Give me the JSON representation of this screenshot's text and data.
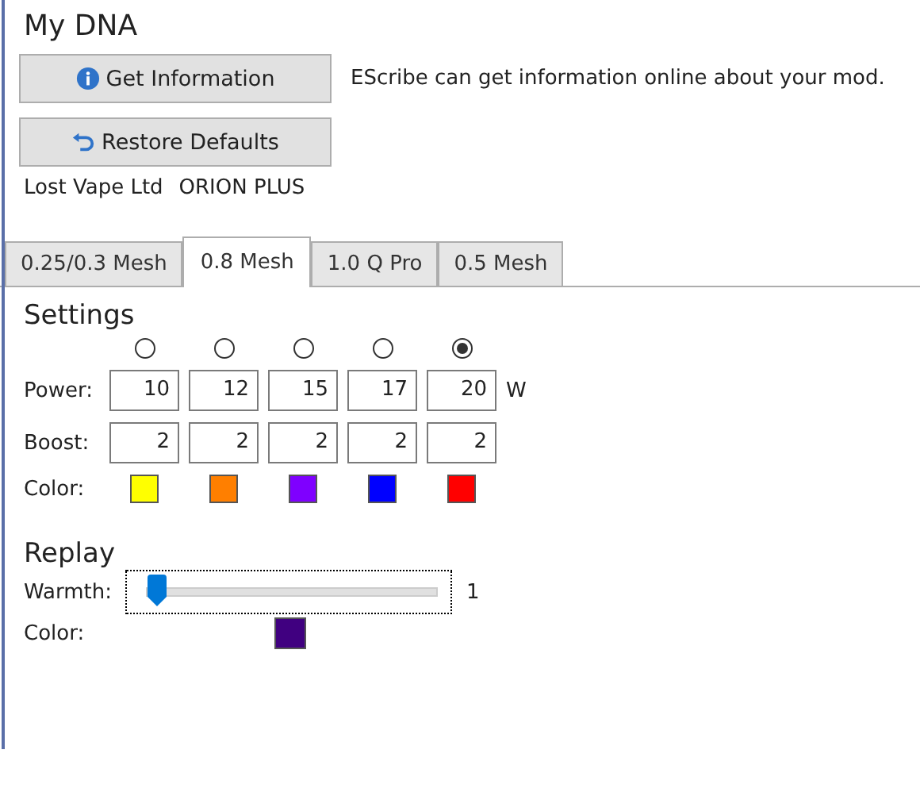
{
  "title": "My DNA",
  "buttons": [
    {
      "kind": "info",
      "label": "Get Information"
    },
    {
      "kind": "restore",
      "label": "Restore Defaults"
    }
  ],
  "info_text": "EScribe can get information online about your mod.",
  "manufacturer": "Lost Vape Ltd",
  "product": "ORION PLUS",
  "tabs": [
    {
      "label": "0.25/0.3 Mesh",
      "selected": false
    },
    {
      "label": "0.8 Mesh",
      "selected": true
    },
    {
      "label": "1.0 Q Pro",
      "selected": false
    },
    {
      "label": "0.5 Mesh",
      "selected": false
    }
  ],
  "settings": {
    "heading": "Settings",
    "power_label": "Power:",
    "boost_label": "Boost:",
    "color_label": "Color:",
    "power_unit": "W",
    "presets": [
      {
        "selected": false,
        "power": "10",
        "boost": "2",
        "color": "#ffff00"
      },
      {
        "selected": false,
        "power": "12",
        "boost": "2",
        "color": "#ff7f00"
      },
      {
        "selected": false,
        "power": "15",
        "boost": "2",
        "color": "#7f00ff"
      },
      {
        "selected": false,
        "power": "17",
        "boost": "2",
        "color": "#0000ff"
      },
      {
        "selected": true,
        "power": "20",
        "boost": "2",
        "color": "#ff0000"
      }
    ]
  },
  "replay": {
    "heading": "Replay",
    "warmth_label": "Warmth:",
    "warmth": {
      "level": 0,
      "reading": "1"
    },
    "color_label": "Color:",
    "color": "#400080"
  }
}
